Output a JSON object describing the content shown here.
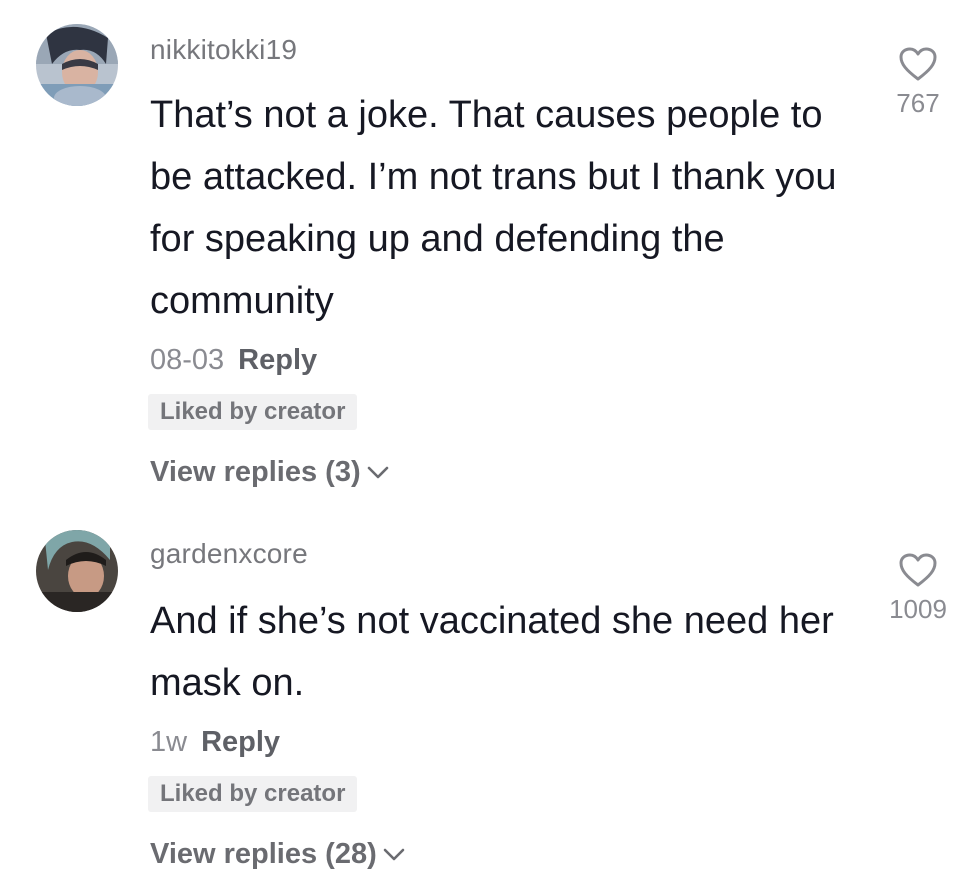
{
  "comments": [
    {
      "username": "nikkitokki19",
      "text": "That’s not a joke. That causes people to be attacked. I’m not trans but I thank you for speaking up and defending the community",
      "date": "08-03",
      "reply_label": "Reply",
      "badge": "Liked by creator",
      "view_replies": "View replies (3)",
      "likes": "767",
      "icons": {
        "like": "heart-outline-icon",
        "expand": "chevron-down-icon"
      }
    },
    {
      "username": "gardenxcore",
      "text": "And if she’s not vaccinated she need her mask on.",
      "date": "1w",
      "reply_label": "Reply",
      "badge": "Liked by creator",
      "view_replies": "View replies (28)",
      "likes": "1009",
      "icons": {
        "like": "heart-outline-icon",
        "expand": "chevron-down-icon"
      }
    }
  ]
}
